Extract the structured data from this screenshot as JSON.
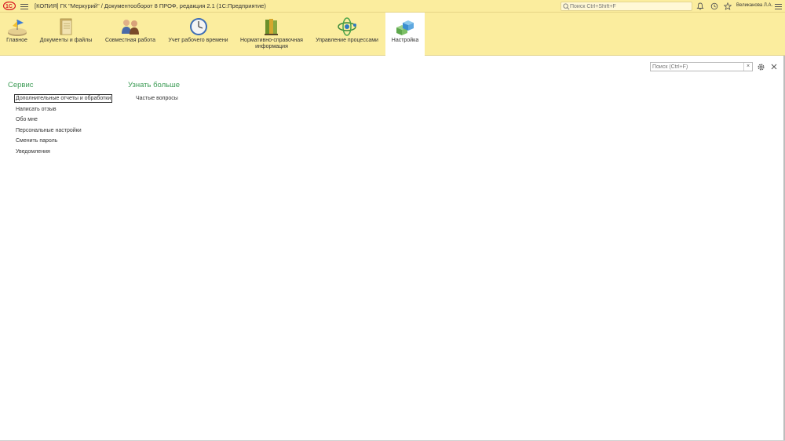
{
  "titlebar": {
    "window_title": "[КОПИЯ] ГК \"Меркурий\" / Документооборот 8 ПРОФ, редакция 2.1  (1С:Предприятие)",
    "search_placeholder": "Поиск Ctrl+Shift+F",
    "user_name": "Великанова Л.А.",
    "icons": [
      "logo-1c",
      "menu-icon",
      "search-icon",
      "bell-icon",
      "history-icon",
      "star-icon",
      "more-menu-icon"
    ]
  },
  "sections": [
    {
      "label": "Главное",
      "icon": "home-icon"
    },
    {
      "label": "Документы и файлы",
      "icon": "documents-icon"
    },
    {
      "label": "Совместная работа",
      "icon": "collaboration-icon"
    },
    {
      "label": "Учет рабочего времени",
      "icon": "clock-icon"
    },
    {
      "label": "Нормативно-справочная\nинформация",
      "icon": "reference-books-icon"
    },
    {
      "label": "Управление процессами",
      "icon": "process-icon"
    },
    {
      "label": "Настройка",
      "icon": "settings-cubes-icon",
      "active": true
    }
  ],
  "form": {
    "search_placeholder": "Поиск (Ctrl+F)",
    "clear_label": "×"
  },
  "groups": {
    "service": {
      "title": "Сервис",
      "items": [
        "Дополнительные отчеты и обработки",
        "Написать отзыв",
        "Обо мне",
        "Персональные настройки",
        "Сменить пароль",
        "Уведомления"
      ]
    },
    "learn_more": {
      "title": "Узнать больше",
      "items": [
        "Частые вопросы"
      ]
    }
  },
  "colors": {
    "panel_bg": "#fbed9e",
    "group_title": "#3b9b54",
    "text": "#333333"
  }
}
